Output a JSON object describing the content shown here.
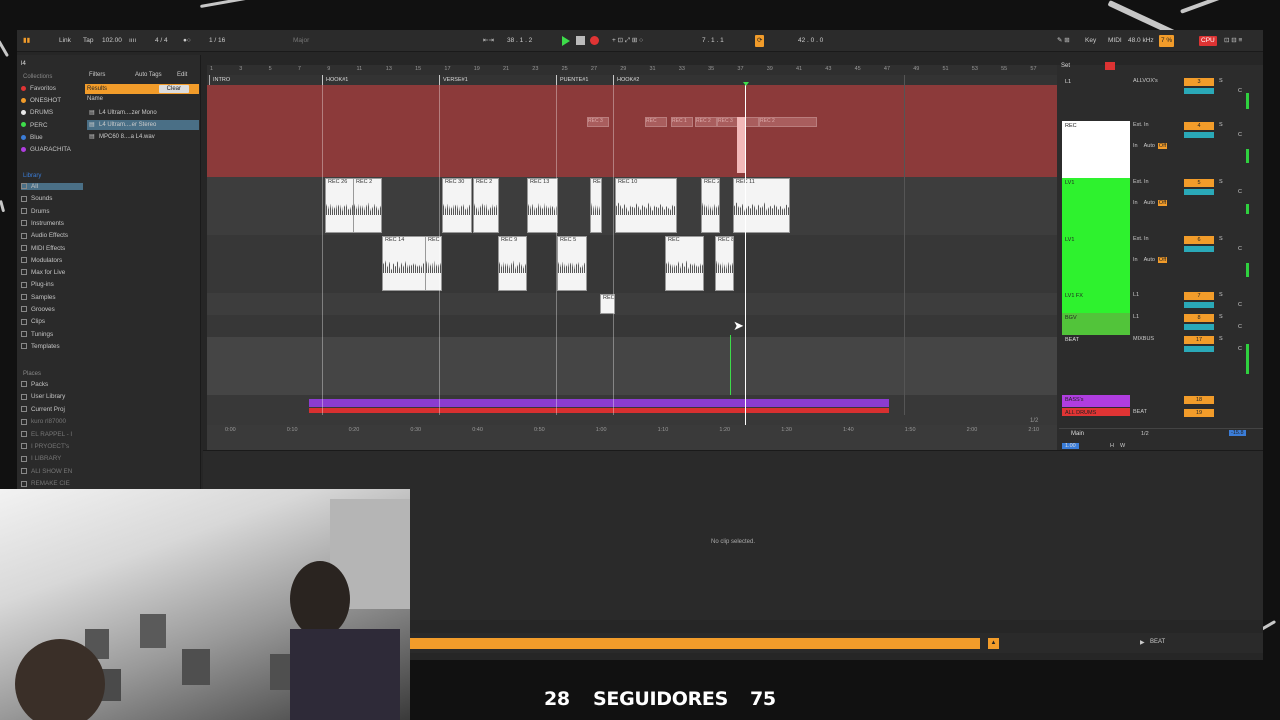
{
  "toolbar": {
    "link": "Link",
    "tap": "Tap",
    "tempo": "102.00",
    "sig": "4 / 4",
    "quant": "1 / 16",
    "key_scale": "Major",
    "position": "38 . 1 . 2",
    "loop_start": "7 . 1 . 1",
    "loop_len": "42 . 0 . 0",
    "key": "Key",
    "midi": "MIDI",
    "sample_rate": "48.0 kHz",
    "cpu": "7 %",
    "cpu_label": "CPU"
  },
  "browser": {
    "search": "l4",
    "filters": "Filters",
    "auto_tags": "Auto Tags",
    "edit": "Edit",
    "results": "Results",
    "clear": "Clear",
    "name_header": "Name",
    "collections_title": "Collections",
    "collections": [
      {
        "label": "Favoritos",
        "color": "#e03434"
      },
      {
        "label": "ONESHOT",
        "color": "#f29c2a"
      },
      {
        "label": "DRUMS",
        "color": "#e8e8e8"
      },
      {
        "label": "PERC",
        "color": "#3ddc4a"
      },
      {
        "label": "Blue",
        "color": "#3b7dd8"
      },
      {
        "label": "GUARACHITA",
        "color": "#b03de0"
      }
    ],
    "files": [
      "L4 Ultram....zer Mono",
      "L4 Ultram....er Stereo",
      "MPC60 8....a L4.wav"
    ],
    "library_title": "Library",
    "library": [
      "All",
      "Sounds",
      "Drums",
      "Instruments",
      "Audio Effects",
      "MIDI Effects",
      "Modulators",
      "Max for Live",
      "Plug-ins",
      "Samples",
      "Grooves",
      "Clips",
      "Tunings",
      "Templates"
    ],
    "places_title": "Places",
    "places": [
      "Packs",
      "User Library",
      "Current Proj",
      "kuro rl87000",
      "EL RAPPEL - I",
      "I PRYOECT's",
      "I LIBRARY",
      "ALI SHOW EN",
      "REMAKE CIE"
    ]
  },
  "arrange": {
    "bar_numbers": [
      "1",
      "3",
      "5",
      "7",
      "9",
      "11",
      "13",
      "15",
      "17",
      "19",
      "21",
      "23",
      "25",
      "27",
      "29",
      "31",
      "33",
      "35",
      "37",
      "39",
      "41",
      "43",
      "45",
      "47",
      "49",
      "51",
      "53",
      "55",
      "57"
    ],
    "markers": [
      {
        "label": "INTRO"
      },
      {
        "label": "HOOK#1"
      },
      {
        "label": "VERSE#1"
      },
      {
        "label": "PUENTE#1"
      },
      {
        "label": "HOOK#2"
      }
    ],
    "ghost_clips": [
      "REC 3",
      "REC",
      "REC 1",
      "REC 2",
      "REC 3",
      "RE",
      "REC 2"
    ],
    "lane1_clips": [
      "REC 26",
      "REC 2",
      "REC 30",
      "REC 2",
      "REC 13",
      "REC",
      "REC 10",
      "REC 2",
      "REC 11"
    ],
    "lane2_clips": [
      "REC 14",
      "REC 1",
      "REC 9",
      "REC 5",
      "REC",
      "REC 8"
    ],
    "lane3_clips": [
      "REC"
    ],
    "time_ruler": [
      "0:00",
      "0:10",
      "0:20",
      "0:30",
      "0:40",
      "0:50",
      "1:00",
      "1:10",
      "1:20",
      "1:30",
      "1:40",
      "1:50",
      "2:00",
      "2:10"
    ],
    "zoom": "1/2"
  },
  "mixer": {
    "tracks": [
      {
        "name": "L1",
        "in": "ALLVOX's",
        "num": "3",
        "color": "#2c2c2c"
      },
      {
        "name": "REC",
        "in": "Ext. In",
        "num": "4",
        "color": "#ffffff",
        "mon": "Auto",
        "off": "Off"
      },
      {
        "name": "LV1",
        "in": "Ext. In",
        "num": "5",
        "color": "#2ef22e",
        "mon": "Auto",
        "off": "Off"
      },
      {
        "name": "LV1",
        "in": "Ext. In",
        "num": "6",
        "color": "#2ef22e",
        "mon": "Auto",
        "off": "Off"
      },
      {
        "name": "LV1 FX",
        "in": "L1",
        "num": "7",
        "color": "#2ef22e"
      },
      {
        "name": "BGV",
        "in": "L1",
        "num": "8",
        "color": "#52c43a"
      },
      {
        "name": "BEAT",
        "in": "MIXBUS",
        "num": "17",
        "color": "#2c2c2c"
      },
      {
        "name": "BASS's",
        "in": "",
        "num": "18",
        "color": "#b03de0"
      },
      {
        "name": "ALL DRUMS",
        "in": "BEAT",
        "num": "19",
        "color": "#e03434"
      }
    ],
    "main": "Main",
    "main_in": "1/2",
    "main_vol": "-15.8",
    "set": "Set",
    "in_label": "In",
    "solo": "S",
    "c_label": "C",
    "vol_main": "1.00",
    "h": "H",
    "w": "W"
  },
  "detail": {
    "empty": "No clip selected."
  },
  "bottom": {
    "track": "BEAT"
  },
  "overlay": {
    "left_num": "28",
    "label": "SEGUIDORES",
    "right_num": "75"
  }
}
